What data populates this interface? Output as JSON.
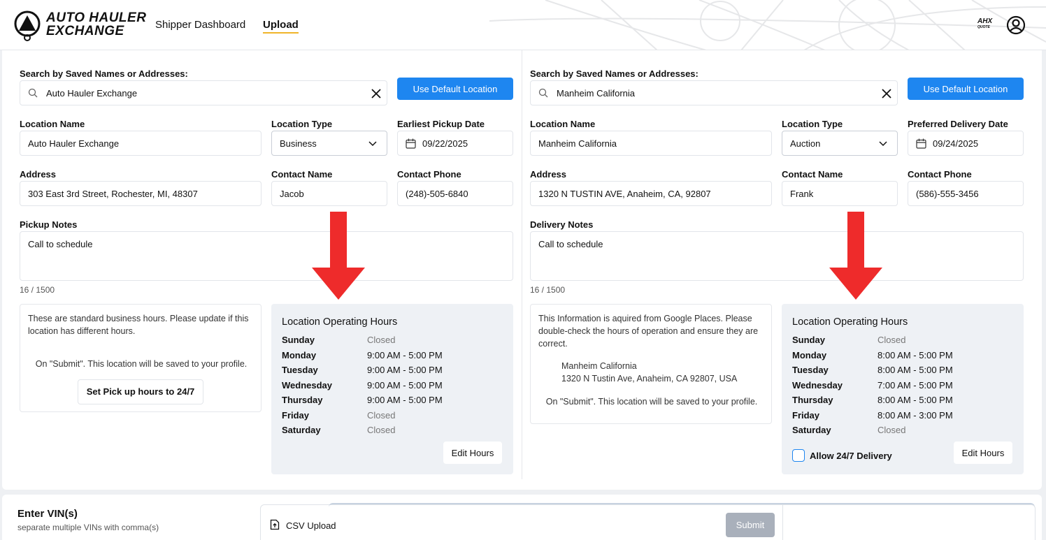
{
  "header": {
    "brand_line1": "AUTO HAULER",
    "brand_line2": "EXCHANGE",
    "nav": [
      "Shipper Dashboard",
      "Upload"
    ],
    "badge_top": "AHX",
    "badge_bottom": "QUOTE"
  },
  "pickup": {
    "search_label": "Search by Saved Names or Addresses:",
    "search_value": "Auto Hauler Exchange",
    "default_btn": "Use Default Location",
    "name_label": "Location Name",
    "name_value": "Auto Hauler Exchange",
    "type_label": "Location Type",
    "type_value": "Business",
    "date_label": "Earliest Pickup Date",
    "date_value": "09/22/2025",
    "address_label": "Address",
    "address_value": "303 East 3rd Street, Rochester, MI, 48307",
    "contact_label": "Contact Name",
    "contact_value": "Jacob",
    "phone_label": "Contact Phone",
    "phone_value": "(248)-505-6840",
    "notes_label": "Pickup Notes",
    "notes_value": "Call to schedule",
    "counter": "16 / 1500",
    "info1": "These are standard business hours. Please update if this location has different hours.",
    "info2": "On \"Submit\". This location will be saved to your profile.",
    "btn_24": "Set Pick up hours to 24/7",
    "hours_title": "Location Operating Hours",
    "hours": [
      {
        "day": "Sunday",
        "time": "Closed",
        "closed": true
      },
      {
        "day": "Monday",
        "time": "9:00 AM - 5:00 PM",
        "closed": false
      },
      {
        "day": "Tuesday",
        "time": "9:00 AM - 5:00 PM",
        "closed": false
      },
      {
        "day": "Wednesday",
        "time": "9:00 AM - 5:00 PM",
        "closed": false
      },
      {
        "day": "Thursday",
        "time": "9:00 AM - 5:00 PM",
        "closed": false
      },
      {
        "day": "Friday",
        "time": "Closed",
        "closed": true
      },
      {
        "day": "Saturday",
        "time": "Closed",
        "closed": true
      }
    ],
    "edit_btn": "Edit Hours"
  },
  "delivery": {
    "search_label": "Search by Saved Names or Addresses:",
    "search_value": "Manheim California",
    "default_btn": "Use Default Location",
    "name_label": "Location Name",
    "name_value": "Manheim California",
    "type_label": "Location Type",
    "type_value": "Auction",
    "date_label": "Preferred Delivery Date",
    "date_value": "09/24/2025",
    "address_label": "Address",
    "address_value": "1320 N TUSTIN AVE, Anaheim, CA, 92807",
    "contact_label": "Contact Name",
    "contact_value": "Frank",
    "phone_label": "Contact Phone",
    "phone_value": "(586)-555-3456",
    "notes_label": "Delivery Notes",
    "notes_value": "Call to schedule",
    "counter": "16 / 1500",
    "info1": "This Information is aquired from Google Places. Please double-check the hours of operation and ensure they are correct.",
    "place_name": "Manheim California",
    "place_addr": "1320 N Tustin Ave, Anaheim, CA 92807, USA",
    "info2": "On \"Submit\". This location will be saved to your profile.",
    "hours_title": "Location Operating Hours",
    "hours": [
      {
        "day": "Sunday",
        "time": "Closed",
        "closed": true
      },
      {
        "day": "Monday",
        "time": "8:00 AM - 5:00 PM",
        "closed": false
      },
      {
        "day": "Tuesday",
        "time": "8:00 AM - 5:00 PM",
        "closed": false
      },
      {
        "day": "Wednesday",
        "time": "7:00 AM - 5:00 PM",
        "closed": false
      },
      {
        "day": "Thursday",
        "time": "8:00 AM - 5:00 PM",
        "closed": false
      },
      {
        "day": "Friday",
        "time": "8:00 AM - 3:00 PM",
        "closed": false
      },
      {
        "day": "Saturday",
        "time": "Closed",
        "closed": true
      }
    ],
    "allow_label": "Allow 24/7 Delivery",
    "edit_btn": "Edit Hours"
  },
  "vin": {
    "title": "Enter VIN(s)",
    "hint": "separate multiple VINs with comma(s)",
    "csv": "CSV Upload",
    "submit": "Submit"
  },
  "colors": {
    "accent": "#1e86f0",
    "arrow": "#ee2b2b",
    "hours_bg": "#eef1f5"
  }
}
